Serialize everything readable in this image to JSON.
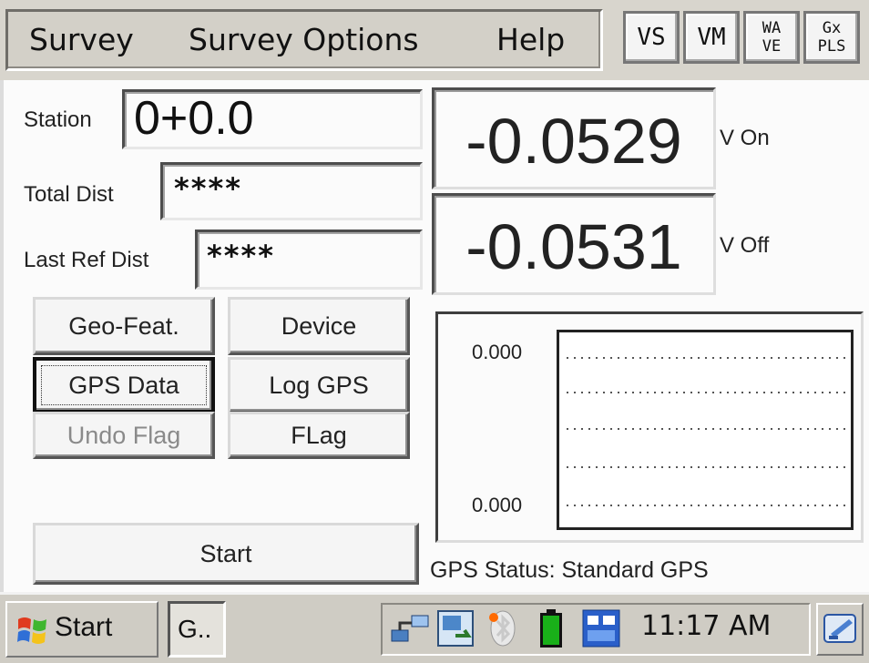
{
  "menu": {
    "survey": "Survey",
    "survey_options": "Survey Options",
    "help": "Help"
  },
  "toolbar": {
    "vs": "VS",
    "vm": "VM",
    "wave_top": "WA",
    "wave_bottom": "VE",
    "gxpls_top": "Gx",
    "gxpls_bottom": "PLS"
  },
  "fields": {
    "station_label": "Station",
    "station_value": "0+0.0",
    "total_dist_label": "Total Dist",
    "total_dist_value": "****",
    "last_ref_dist_label": "Last Ref Dist",
    "last_ref_dist_value": "****"
  },
  "readouts": {
    "von_value": "-0.0529",
    "von_unit": "V On",
    "voff_value": "-0.0531",
    "voff_unit": "V Off"
  },
  "buttons": {
    "geo_feat": "Geo-Feat.",
    "device": "Device",
    "gps_data": "GPS Data",
    "log_gps": "Log GPS",
    "undo_flag": "Undo Flag",
    "flag": "FLag",
    "start": "Start"
  },
  "chart": {
    "y_top": "0.000",
    "y_bottom": "0.000"
  },
  "gps_status": "GPS Status: Standard GPS",
  "taskbar": {
    "start": "Start",
    "task": "G..",
    "clock": "11:17 AM"
  },
  "icons": [
    "windows-flag-icon",
    "network-icon",
    "sync-icon",
    "bluetooth-icon",
    "battery-icon",
    "input-panel-icon",
    "desktop-icon"
  ],
  "colors": {
    "panel": "#fbfbfb",
    "chrome": "#d3d0c8",
    "battery": "#19b019",
    "flag_red": "#e03a1e",
    "flag_green": "#3fb62f",
    "flag_blue": "#2f6fd6",
    "flag_yellow": "#f4c31b"
  }
}
